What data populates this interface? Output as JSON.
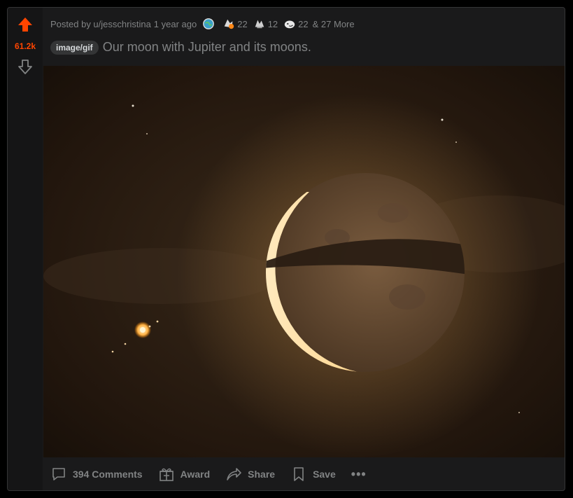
{
  "post": {
    "score": "61.2k",
    "meta": {
      "posted_by": "Posted by u/jesschristina",
      "time": "1 year ago",
      "awards": [
        {
          "icon": "globe-award-icon",
          "count": ""
        },
        {
          "icon": "wholesome-award-icon",
          "count": "22"
        },
        {
          "icon": "helpful-award-icon",
          "count": "12"
        },
        {
          "icon": "silver-award-icon",
          "count": "22"
        }
      ],
      "more": "& 27 More"
    },
    "flair": "image/gif",
    "title": "Our moon with Jupiter and its moons.",
    "actions": {
      "comments": "394 Comments",
      "award": "Award",
      "share": "Share",
      "save": "Save",
      "more": "•••"
    }
  },
  "colors": {
    "upvote": "#ff4500",
    "background": "#1a1a1b",
    "text_muted": "#818384"
  }
}
